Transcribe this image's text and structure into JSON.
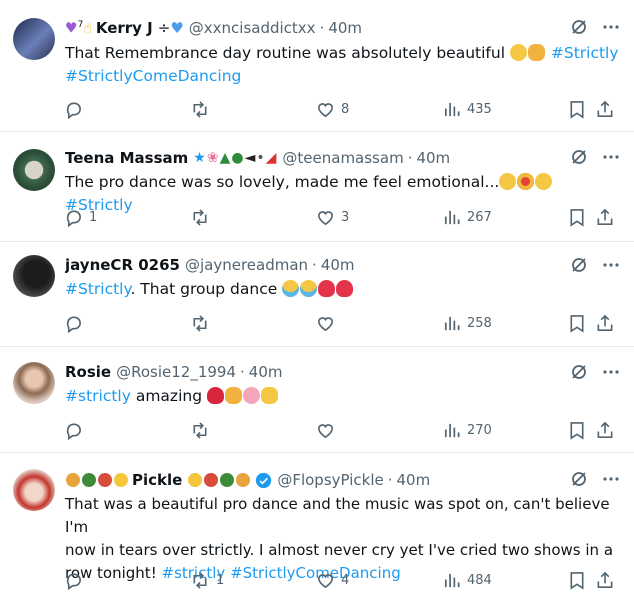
{
  "tweets": [
    {
      "name": "Kerry J",
      "name_prefix": "💜⁷👆",
      "name_suffix": "➗💙",
      "handle": "@xxncisaddictxx",
      "time": "40m",
      "text": "That Remembrance day routine was absolutely beautiful",
      "tags": [
        "#Strictly",
        "#StrictlyComeDancing"
      ],
      "replies": "",
      "retweets": "",
      "likes": "8",
      "views": "435"
    },
    {
      "name": "Teena Massam",
      "handle": "@teenamassam",
      "time": "40m",
      "text": "The pro dance was so lovely, made me feel emotional...",
      "tags": [
        "#Strictly"
      ],
      "replies": "1",
      "retweets": "",
      "likes": "3",
      "views": "267"
    },
    {
      "name": "jayneCR 0265",
      "handle": "@jaynereadman",
      "time": "40m",
      "tags": [
        "#Strictly"
      ],
      "text": ". That group dance",
      "replies": "",
      "retweets": "",
      "likes": "",
      "views": "258"
    },
    {
      "name": "Rosie",
      "handle": "@Rosie12_1994",
      "time": "40m",
      "tags": [
        "#strictly"
      ],
      "text": " amazing",
      "replies": "",
      "retweets": "",
      "likes": "",
      "views": "270"
    },
    {
      "name": "Pickle",
      "handle": "@FlopsyPickle",
      "time": "40m",
      "text_line1": "That was a beautiful pro dance and the music was spot on, can't believe I'm",
      "text_line2": "now in tears over strictly. I almost never cry yet I've cried two shows in a",
      "text_line3": "row tonight!",
      "tags": [
        "#strictly",
        "#StrictlyComeDancing"
      ],
      "replies": "",
      "retweets": "1",
      "likes": "4",
      "views": "484"
    }
  ],
  "separator": "·",
  "icons": [
    "reply-icon",
    "retweet-icon",
    "like-icon",
    "views-icon",
    "bookmark-icon",
    "share-icon",
    "grok-icon",
    "more-icon",
    "verified-icon"
  ],
  "colors": {
    "accent": "#1d9bf0",
    "muted": "#536471",
    "text": "#0f1419",
    "border": "#e6ecf0"
  }
}
